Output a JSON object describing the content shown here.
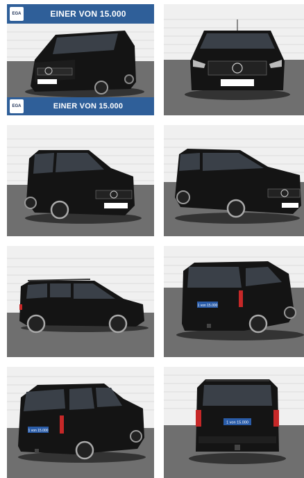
{
  "banner": {
    "top_text": "EINER VON 15.000",
    "bottom_text": "EINER VON 15.000",
    "logo_text": "EGA",
    "color": "#2f5f99"
  },
  "photos": [
    {
      "view": "front-three-quarter",
      "has_banner": true
    },
    {
      "view": "front"
    },
    {
      "view": "front-left-three-quarter"
    },
    {
      "view": "front-right-three-quarter"
    },
    {
      "view": "left-side"
    },
    {
      "view": "rear-right-three-quarter",
      "plate_text": "1 von 15.000"
    },
    {
      "view": "rear-left-three-quarter",
      "plate_text": "1 von 15.000"
    },
    {
      "view": "rear",
      "plate_text": "1 von 15.000"
    }
  ],
  "colors": {
    "wall": "#f0f0f0",
    "brick_line": "#dcdcdc",
    "floor": "#6f6f6f",
    "car_body": "#141414",
    "plate_blue": "#2a5ca8"
  }
}
